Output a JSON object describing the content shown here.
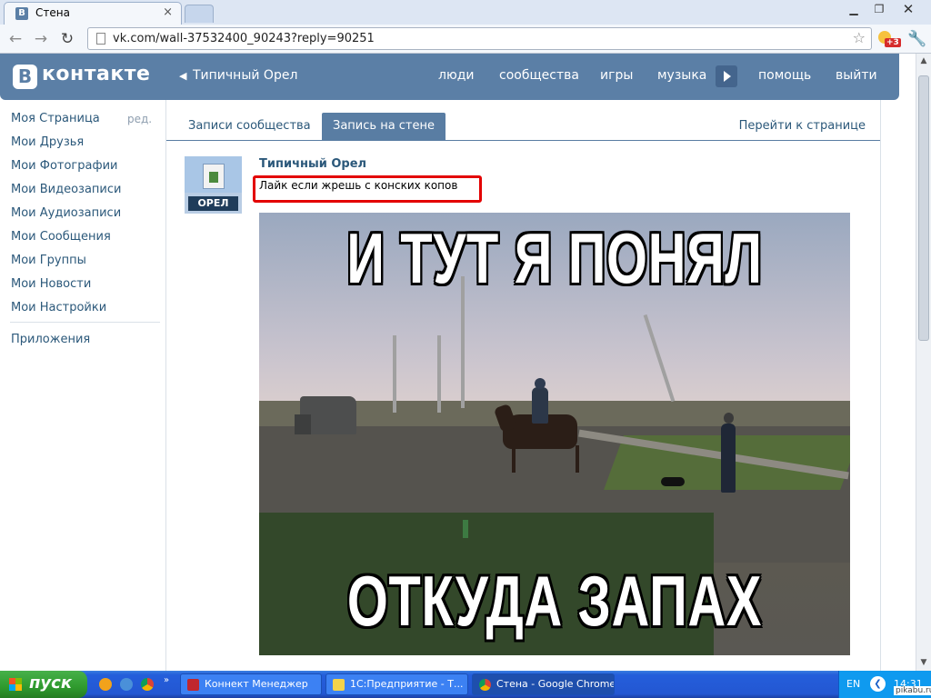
{
  "browser": {
    "tab_title": "Стена",
    "tab_close": "×",
    "url": "vk.com/wall-37532400_90243?reply=90251",
    "extension_badge": "+3"
  },
  "vk": {
    "logo_letter": "В",
    "logo_text": "контакте",
    "group_back": "Типичный Орел",
    "nav": [
      "люди",
      "сообщества",
      "игры",
      "музыка",
      "помощь",
      "выйти"
    ]
  },
  "sidebar": {
    "items": [
      "Моя Страница",
      "Мои Друзья",
      "Мои Фотографии",
      "Мои Видеозаписи",
      "Мои Аудиозаписи",
      "Мои Сообщения",
      "Мои Группы",
      "Мои Новости",
      "Мои Настройки"
    ],
    "edit": "ред.",
    "apps": "Приложения"
  },
  "tabs": {
    "community_posts": "Записи сообщества",
    "wall_post": "Запись на стене",
    "go_to_page": "Перейти к странице"
  },
  "post": {
    "avatar_label": "ОРЕЛ",
    "author": "Типичный Орел",
    "text": "Лайк если жрешь с конских копов",
    "image_caption_top": "И ТУТ Я ПОНЯЛ",
    "image_caption_bottom": "ОТКУДА ЗАПАХ"
  },
  "taskbar": {
    "start": "пуск",
    "tasks": [
      "Коннект Менеджер",
      "1С:Предприятие - Т...",
      "Стена - Google Chrome"
    ],
    "lang": "EN",
    "clock": "14:31"
  },
  "watermark": "pikabu.ru"
}
